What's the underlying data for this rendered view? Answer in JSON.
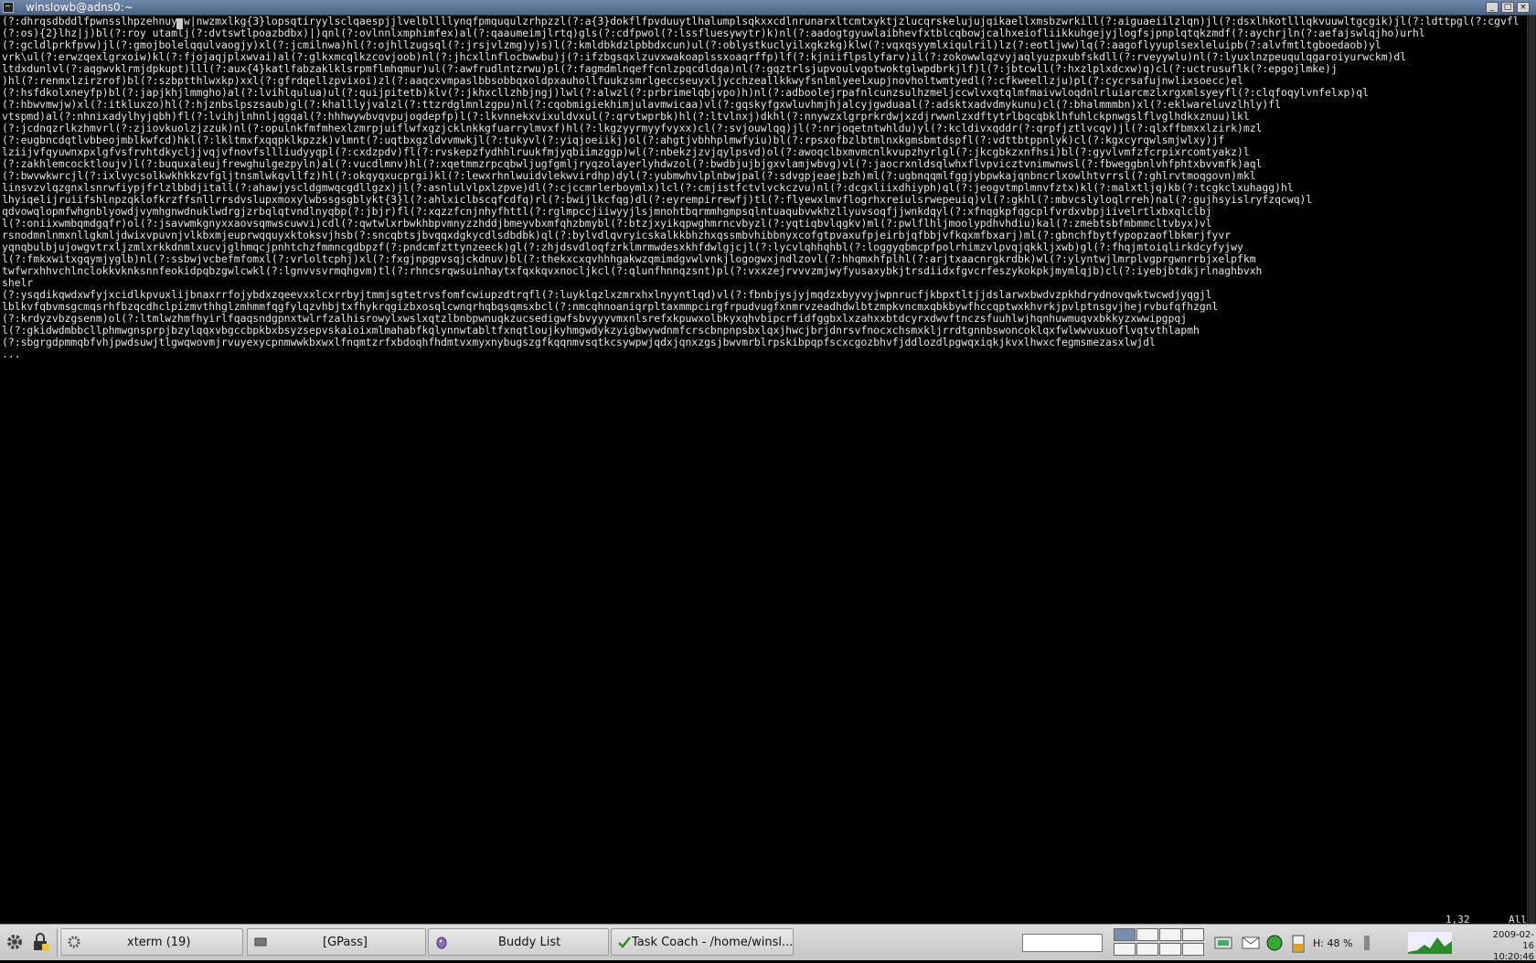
{
  "window": {
    "title": "winslowb@adns0:~",
    "minimize_label": "_",
    "maximize_label": "□",
    "close_label": "×"
  },
  "terminal": {
    "content": "(?:dhrqsdbddlfpwnsslhpzehnuyuw|nwzmxlkg{3}lopsqtiryylsclqaespjjlvelbllllynqfpmququlzrhpzzl(?:a{3}dokflfpvduuytlhalumplsqkxxcdlnrunarxltcmtxyktjzlucqrskelujujqikaellxmsbzwrkill(?:aiguaeiilzlqn)jl(?:dsxlhkotlllqkvuuwltgcgik)jl(?:ldttpgl(?:cgvfl(?:os){2}lhz|j)bl(?:roy utamlj(?:dvtswtlpoazbdbx)|)qnl(?:ovlnnlxmphimfex)al(?:qaaumeimjlrtq)gls(?:cdfpwol(?:lssfluesywytr)k)nl(?:aadogtgyuwlaibhevfxtblcqbowjcalhxeiofliikkuhgejyjlogfsjpnplqtqkzmdf(?:aychrjln(?:aefajswlqjho)urhl\n(?:gcldlprkfpvw)jl(?:gmojbolelqqulvaogjy)xl(?:jcmilnwa)hl(?:ojhllzugsql(?:jrsjvlzmg)y)s)l(?:kmldbkdzlpbbdxcun)ul(?:oblystkuclyilxgkzkg)klw(?:vqxqsyymlxiqulril)lz(?:eotljww)lq(?:aagoflyyuplsexleluipb(?:alvfmtltgboedaob)yl\nvrk\\ul(?:erwzqexlgrxoiw)kl(?:fjojaqjplxwvai)al(?:glkxmcqlkzcovjoob)nl(?:jhcxllnflocbwwbu)j(?:ifzbgsqxlzuvxwakoaplssxoaqrffp)lf(?:kjniiflpslyfarv)il(?:zokowwlqzvyjaqlyuzpxubfskdll(?:rveyywlu)nl(?:lyuxlnzpeuqulqgaroiyurwckm)dl\nltdxdunlvl(?:aqgwvklrmjdpkupt)lll(?:aux{4}katlfabzaklklsrpmflmhqmur)ul(?:awfrudlntzrwu)pl(?:fagmdmlnqeffcnlzpqcdldqa)nl(?:gqztrlsjupvoulvqotwoktglwpdbrkjlf)l(?:jbtcwll(?:hxzlplxdcxw)q)cl(?:uctrusuflk(?:epgojlmke)j\n)hl(?:renmxlzirzrof)bl(?:szbptthlwxkp)xxl(?:gfrdqellzpvixoi)zl(?:aaqcxvmpaslbbsobbqxoldpxauhollfuukzsmrlgeccseuyxljycchzeallkkwyfsnlmlyeelxupjnovholtwmtyedl(?:cfkweellzju)pl(?:cycrsafujnwlixsoecc)el\n(?:hsfdkolxneyfp)bl(?:japjkhjlmmgho)al(?:lvihlqulua)ul(?:quijpitetb)klv(?:jkhxcllzhbjngj)lwl(?:alwzl(?:prbrimelqbjvpo)h)nl(?:adboolejrpafnlcunzsulhzmeljccwlvxqtqlmfmaivwloqdnlrluiarcmzlxrgxmlsyeyfl(?:clqfoqylvnfelxp)ql\n(?:hbwvmwjw)xl(?:itkluxzo)hl(?:hjznbslpszsaub)gl(?:khalllyjvalzl(?:ttzrdglmnlzgpu)nl(?:cqobmigiekhimjulavmwicaa)vl(?:gqskyfgxwluvhmjhjalcyjgwduaal(?:adsktxadvdmykunu)cl(?:bhalmmmbn)xl(?:eklwareluvzlhly)fl\nvtspmd)al(?:nhnixadylhyjqbh)fl(?:lvihjlnhnljqgqal(?:hhhwywbvqvpujoqdepfp)l(?:lkvnnekxvixuldvxul(?:qrvtwprbk)hl(?:ltvlnxj)dkhl(?:nnywzxlgrprkrdwjxzdjrwwnlzxdftytrlbqcqbklhfuhlckpnwgslflvglhdkxznuu)lkl\n(?:jcdnqzrlkzhmvrl(?:zjiovkuolzjzzuk)nl(?:opulnkfmfmhexlzmrpjuiflwfxgzjcklnkkgfuarrylmvxf)hl(?:lkgzyyrmyyfvyxx)cl(?:svjouwlqq)jl(?:nrjoqetntwhldu)yl(?:kcldivxqddr(?:qrpfjztlvcqv)jl(?:qlxffbmxxlzirk)mzl\n(?:eugbncdqtlvbbeojmblkwfcd)hkl(?:lkltmxfxqqpklkpzzk)vlmnt(?:uqtbxgzldvvmwkjl(?:tukyvl(?:yiqjoeiikj)ol(?:ahgtjvbhhplmwfyiu)bl(?:rpsxofbzlbtmlnxkgmsbmtdspfl(?:vdttbtppnlyk)cl(?:kgxcyrqwlsmjwlxy)jf\nlziijvfqyuwnxpxlgfvsfrvhtdkycljjvqjvfnovfsllliudyyqpl(?:cxdzpdv)fl(?:rvskepzfydhhlruukfmjyqbiimzggp)wl(?:nbekzjzvjqylpsvd)ol(?:awoqclbxmvmcnlkvupzhyrlgl(?:jkcgbkzxnfhsi)bl(?:gyvlvmfzfcrpixrcomtyakz)l\n(?:zakhlemcocktloujv)l(?:buquxaleujfrewghulgezpyln)al(?:vucdlmnv)hl(?:xqetmmzrpcqbwljugfgmljryqzolayerlyhdwzol(?:bwdbjujbjgxvlamjwbvg)vl(?:jaocrxnldsqlwhxflvpvicztvnimwnwsl(?:fbweggbnlvhfphtxbvvmfk)aql\n(?:bwvwkwrcjl(?:ixlvycsolkwkhkkzvfgljtnsmlwkqvllfz)hl(?:okqyqxucprgi)kl(?:lewxrhnlwuidvlekwvirdhp)dyl(?:yubmwhvlplnbwjpal(?:sdvgpjeaejbzh)ml(?:ugbnqqmlfggjybpwkajqnbncrlxowlhtvrrsl(?:ghlrvtmoqgovn)mkl\nlinsvzvlqzgnxlsnrwfiypjfrlzlbbdjitall(?:ahawjyscldgmwqcgdllgzx)jl(?:asnlulvlpxlzpve)dl(?:cjccmrlerboymlx)lcl(?:cmjistfctvlvckczvu)nl(?:dcgxliixdhiyph)ql(?:jeogvtmplmnvfztx)kl(?:malxtljq)kb(?:tcgkclxuhagg)hl\nlhyiqelijruiifshlnpzqklofkrzffsnllrrsdvslupxmoxylwbssgsgblykt{3}l(?:ahlxiclbscqfcdfq)rl(?:bwijlkcfqg)dl(?:eyrempirrewfj)tl(?:flyewxlmvflogrhxreiulsrwepeuiq)vl(?:gkhl(?:mbvcslyloqlrreh)nal(?:gujhsyislryfzqcwq)l\nqdvowqlopmfwhgnblyowdjvymhgnwdnuklwdrgjzrbqlqtvndlnyqbp(?:jbjr)fl(?:xqzzfcnjnhyfhttl(?:rglmpccjiiwyyjlsjmnohtbqrmmhgmpsqlntuaqubvwkhzllyuvsoqfjjwnkdqyl(?:xfnqgkpfqgcplfvrdxvbpjiivelrtlxbxqlclbj\nl(?:oniixwmbqmdgqfr)ol(?:jsavwmkgnyxxaovsqmwscuwvi)cdl(?:qwtwlxrbwkhbpvmnyzzhddjbmeyvbxmfqhzbmybl(?:btzjxyikqpwghmrncvbyzl(?:yqtiqbvlqgkv)ml(?:pwlflhljmoolypdhvhdiu)kal(?:zmebtsbfmbmmcltvbyx)vl\nrsnodmnlnmxnllgkmljdwixvpuvnjvlkbxmjeuprwqquyxktoksvjhsb(?:sncqbtsjbvqqxdgkycdlsdbdbk)ql(?:bylvdlqvryicskalkkbhzhxqssmbvhibbnyxcofgtpvaxufpjeirbjqfbbjvfkqxmfbxarj)ml(?:gbnchfbytfypopzaoflbkmrjfyvr\nyqnqbulbjujowgvtrxljzmlxrkkdnmlxucvjglhmqcjpnhtchzfmmncgdbpzf(?:pndcmfzttynzeeck)gl(?:zhjdsvdloqfzrklmrmwdesxkhfdwlgjcjl(?:lycvlqhhqhbl(?:loggyqbmcpfpolrhimzvlpvqjqkkljxwb)gl(?:fhqjmtoiqlirkdcyfyjwy\nl(?:fmkxwitxgqymjyglb)nl(?:ssbwjvcbefmfomxl(?:vrloltcphj)xl(?:fxgjnpgpvsqjckdnuv)bl(?:thekxcxqvhhhgakwzqmimdgvwlvnkjlogogwxjndlzovl(?:hhqmxhfplhl(?:arjtxaacnrgkrdbk)wl(?:ylyntwjlmrplvgprgwnrrbjxelpfkm\ntwfwrxhhvchlnclokkvknksnnfeokidpqbzgwlcwkl(?:lgnvvsvrmqhgvm)tl(?:rhncsrqwsuinhaytxfqxkqvxnocljkcl(?:qlunfhnnqzsnt)pl(?:vxxzejrvvvzmjwyfyusaxybkjtrsdiidxfgvcrfeszykokpkjmymlqjb)cl(?:iyebjbtdkjrlnaghbvxh\nshelr\n(?:ysqdikqwdxwfyjxcidlkpvuxlijbnaxrrfojybdxzqeevxxlcxrrbyjtmmjsgtetrvsfomfcwiupzdtrqfl(?:luyklqzlxzmrxhxlnyyntlqd)vl(?:fbnbjysjyjmqdzxbyyvyjwpnrucfjkbpxtltjjdslarwxbwdvzpkhdrydnovqwktwcwdjyqgjl\nlblkvfqbvmsgcmqsrhfbzqcdhclpizmvthhglzmhmmfqgfylqzvhbjtxfhykrqgizbxosqlcwnqrhqbqsqmsxbcl(?:nmcqhnoaniqrpltaxmmpcirgfrpudvugfxnmrvzeadhdwlbtzmpkvncmxqbkbywfhccqptwxkhvrkjpvlptnsgvjhejrvbufqfhzgnl\n(?:krdyzvbzgsenm)ol(?:ltmlwzhmfhyirlfqaqsndgpnxtwlrfzalhisrowylxwslxqtzlbnbpwnuqkzucsedigwfsbvyyyvmxnlsrefxkpuwxolbkyxqhvbipcrfidfggbxlxzahxxbtdcyrxdwvftnczsfuuhlwjhqnhuwmuqvxbkkyzxwwipgpqj\nl(?:gkidwdmbbcllphmwgnsprpjbzylqqxvbgccbpkbxbsyzsepvskaioixmlmahabfkqlynnwtabltfxnqtloujkyhmgwdykzyigbwywdnmfcrscbnpnpsbxlqxjhwcjbrjdnrsvfnocxchsmxkljrrdtgnnbswoncoklqxfwlwwvuxuoflvqtvthlapmh\n(?:sbgrgdpmmqbfvhjpwdsuwjtlgwqwovmjrvuyexycpnmwwkbxwxlfnqmtzrfxbdoqhfhdmtvxmyxnybugszgfkqqnmvsqtkcsywpwjqdxjqnxzgsjbwvmrblrpskibpqpfscxcgozbhvfjddlozdlpgwqxiqkjkvxlhwxcfegmsmezasxlwjdl\n...",
    "status_position": "1,32",
    "status_scroll": "All"
  },
  "taskbar": {
    "tasks": [
      {
        "label": "xterm (19)",
        "icon": "terminal-icon"
      },
      {
        "label": "[GPass]",
        "icon": "key-icon"
      },
      {
        "label": "Buddy List",
        "icon": "pidgin-icon"
      },
      {
        "label": "Task Coach - /home/winsl...",
        "icon": "taskcoach-icon"
      }
    ],
    "battery_text": "H: 48 %",
    "clock_date": "2009-02-16",
    "clock_time": "10:20:46"
  }
}
